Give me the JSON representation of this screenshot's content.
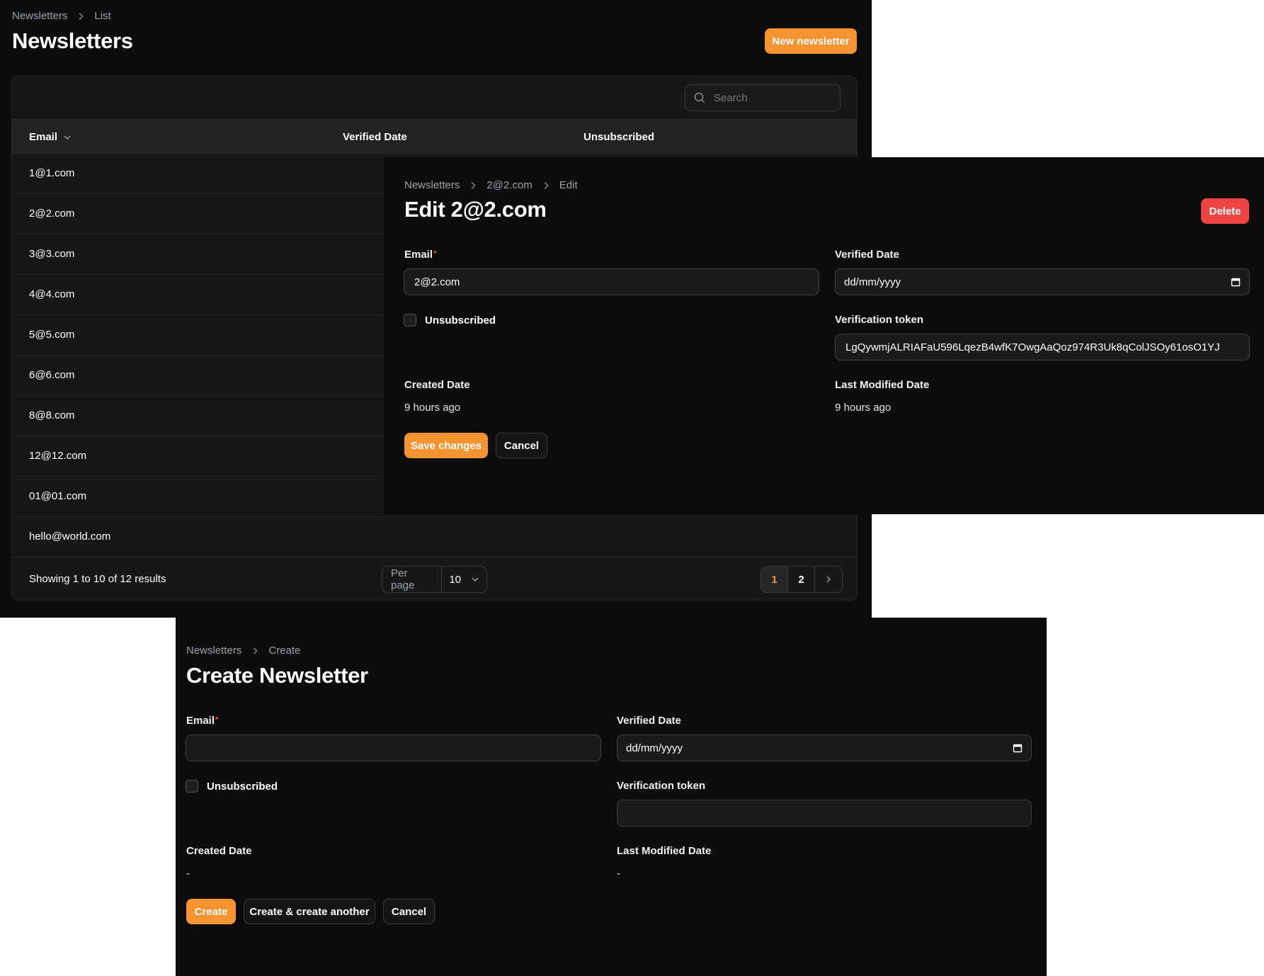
{
  "list": {
    "breadcrumb": [
      "Newsletters",
      "List"
    ],
    "title": "Newsletters",
    "new_button": "New newsletter",
    "search_placeholder": "Search",
    "columns": [
      "Email",
      "Verified Date",
      "Unsubscribed"
    ],
    "rows": [
      "1@1.com",
      "2@2.com",
      "3@3.com",
      "4@4.com",
      "5@5.com",
      "6@6.com",
      "8@8.com",
      "12@12.com",
      "01@01.com",
      "hello@world.com"
    ],
    "showing": "Showing 1 to 10 of 12 results",
    "per_page_label": "Per page",
    "per_page_value": "10",
    "pages": [
      "1",
      "2"
    ],
    "current_page": "1"
  },
  "edit": {
    "breadcrumb": [
      "Newsletters",
      "2@2.com",
      "Edit"
    ],
    "title": "Edit 2@2.com",
    "delete_button": "Delete",
    "email_label": "Email",
    "required_mark": "*",
    "email_value": "2@2.com",
    "verified_label": "Verified Date",
    "verified_value": "dd/mm/yyyy",
    "unsubscribed_label": "Unsubscribed",
    "token_label": "Verification token",
    "token_value": "LgQywmjALRIAFaU596LqezB4wfK7OwgAaQoz974R3Uk8qColJSOy61osO1YJ",
    "created_label": "Created Date",
    "created_value": "9 hours ago",
    "modified_label": "Last Modified Date",
    "modified_value": "9 hours ago",
    "save_button": "Save changes",
    "cancel_button": "Cancel"
  },
  "create": {
    "breadcrumb": [
      "Newsletters",
      "Create"
    ],
    "title": "Create Newsletter",
    "email_label": "Email",
    "required_mark": "*",
    "verified_label": "Verified Date",
    "verified_value": "dd/mm/yyyy",
    "unsubscribed_label": "Unsubscribed",
    "token_label": "Verification token",
    "created_label": "Created Date",
    "created_value": "-",
    "modified_label": "Last Modified Date",
    "modified_value": "-",
    "create_button": "Create",
    "create_another_button": "Create & create another",
    "cancel_button": "Cancel"
  },
  "colors": {
    "accent": "#f59331",
    "danger": "#ef4444",
    "panel": "#0c0c0c",
    "card": "#171717"
  }
}
